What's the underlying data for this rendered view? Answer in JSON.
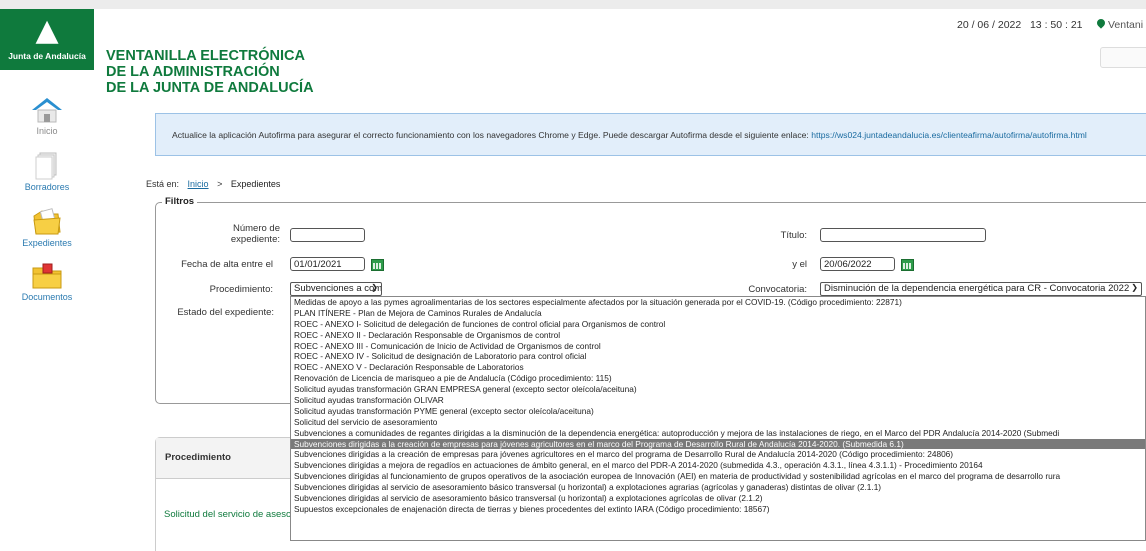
{
  "header": {
    "logo_text": "Junta de Andalucía",
    "title_lines": [
      "VENTANILLA ELECTRÓNICA",
      "DE LA ADMINISTRACIÓN",
      "DE LA JUNTA DE ANDALUCÍA"
    ],
    "datetime": "20 / 06 / 2022   13 : 50 : 21",
    "location_label": "Ventani"
  },
  "sidebar": {
    "items": [
      {
        "label": "Inicio",
        "icon": "home-icon"
      },
      {
        "label": "Borradores",
        "icon": "drafts-icon"
      },
      {
        "label": "Expedientes",
        "icon": "folder-icon"
      },
      {
        "label": "Documentos",
        "icon": "documents-icon"
      }
    ]
  },
  "notice": {
    "text": "Actualice la aplicación Autofirma para asegurar el correcto funcionamiento con los navegadores Chrome y Edge. Puede descargar Autofirma desde el siguiente enlace: ",
    "link": "https://ws024.juntadeandalucia.es/clienteafirma/autofirma/autofirma.html"
  },
  "breadcrumb": {
    "prefix": "Está en:",
    "home": "Inicio",
    "separator": ">",
    "current": "Expedientes"
  },
  "filters": {
    "legend": "Filtros",
    "numero_label_1": "Número de",
    "numero_label_2": "expediente:",
    "numero_value": "",
    "titulo_label": "Título:",
    "titulo_value": "",
    "fecha_label": "Fecha de alta entre el",
    "fecha_desde": "01/01/2021",
    "y_el_label": "y el",
    "fecha_hasta": "20/06/2022",
    "procedimiento_label": "Procedimiento:",
    "procedimiento_value": "Subvenciones a comu",
    "convocatoria_label": "Convocatoria:",
    "convocatoria_value": "Disminución de la dependencia energética para CR - Convocatoria 2022",
    "estado_label": "Estado del expediente:"
  },
  "dropdown_options": [
    "Medidas de apoyo a las pymes agroalimentarias de los sectores especialmente afectados por la situación generada por el COVID-19. (Código procedimiento: 22871)",
    "PLAN ITÍNERE - Plan de Mejora de Caminos Rurales de Andalucía",
    "ROEC - ANEXO I- Solicitud de delegación de funciones de control oficial para Organismos de control",
    "ROEC - ANEXO II - Declaración Responsable de Organismos de control",
    "ROEC - ANEXO III - Comunicación de Inicio de Actividad de Organismos de control",
    "ROEC - ANEXO IV - Solicitud de designación de Laboratorio para control oficial",
    "ROEC - ANEXO V - Declaración Responsable de Laboratorios",
    "Renovación de Licencia de marisqueo a pie de Andalucía (Código procedimiento: 115)",
    "Solicitud ayudas transformación GRAN EMPRESA general (excepto sector oleícola/aceituna)",
    "Solicitud ayudas transformación OLIVAR",
    "Solicitud ayudas transformación PYME general (excepto sector oleícola/aceituna)",
    "Solicitud del servicio de asesoramiento",
    "Subvenciones a comunidades de regantes dirigidas a la disminución de la dependencia energética: autoproducción y mejora de las instalaciones de riego, en el Marco del PDR Andalucía 2014-2020 (Submedi",
    "Subvenciones dirigidas a la creación de empresas para jóvenes agricultores en el marco del Programa de Desarrollo Rural de Andalucía 2014-2020. (Submedida 6.1)",
    "Subvenciones dirigidas a la creación de empresas para jóvenes agricultores en el marco del programa de Desarrollo Rural de Andalucía 2014-2020 (Código procedimiento: 24806)",
    "Subvenciones dirigidas a mejora de regadíos en actuaciones de ámbito general, en el marco del PDR-A 2014-2020 (submedida 4.3., operación 4.3.1., línea 4.3.1.1) - Procedimiento 20164",
    "Subvenciones dirigidas al funcionamiento de grupos operativos de la asociación europea de Innovación (AEI) en materia de productividad y sostenibilidad agrícolas en el marco del programa de desarrollo rura",
    "Subvenciones dirigidas al servicio de asesoramiento básico transversal (u horizontal) a explotaciones agrarias (agrícolas y ganaderas) distintas de olivar (2.1.1)",
    "Subvenciones dirigidas al servicio de asesoramiento básico transversal (u horizontal) a explotaciones agrícolas de olivar (2.1.2)",
    "Supuestos excepcionales de enajenación directa de tierras y bienes procedentes del extinto IARA (Código procedimiento: 18567)"
  ],
  "dropdown_highlighted_index": 13,
  "results": {
    "column_header": "Procedimiento",
    "row_text": "Solicitud del servicio de asesoramiento"
  }
}
